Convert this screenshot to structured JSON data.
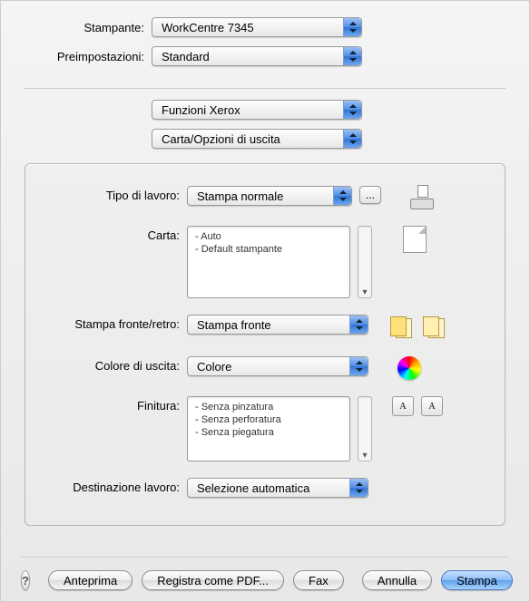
{
  "header": {
    "printer_label": "Stampante:",
    "printer_value": "WorkCentre 7345",
    "presets_label": "Preimpostazioni:",
    "presets_value": "Standard"
  },
  "sections": {
    "pane_select": "Funzioni Xerox",
    "subpane_select": "Carta/Opzioni di uscita"
  },
  "panel": {
    "job_type_label": "Tipo di lavoro:",
    "job_type_value": "Stampa normale",
    "more_button": "...",
    "paper_label": "Carta:",
    "paper_items": [
      "- Auto",
      "- Default stampante"
    ],
    "duplex_label": "Stampa fronte/retro:",
    "duplex_value": "Stampa fronte",
    "color_label": "Colore di uscita:",
    "color_value": "Colore",
    "finishing_label": "Finitura:",
    "finishing_items": [
      "- Senza pinzatura",
      "- Senza perforatura",
      "- Senza piegatura"
    ],
    "finishing_tile_a": "A",
    "finishing_tile_b": "A",
    "dest_label": "Destinazione lavoro:",
    "dest_value": "Selezione automatica"
  },
  "footer": {
    "help": "?",
    "preview": "Anteprima",
    "save_pdf": "Registra come PDF...",
    "fax": "Fax",
    "cancel": "Annulla",
    "print": "Stampa"
  }
}
